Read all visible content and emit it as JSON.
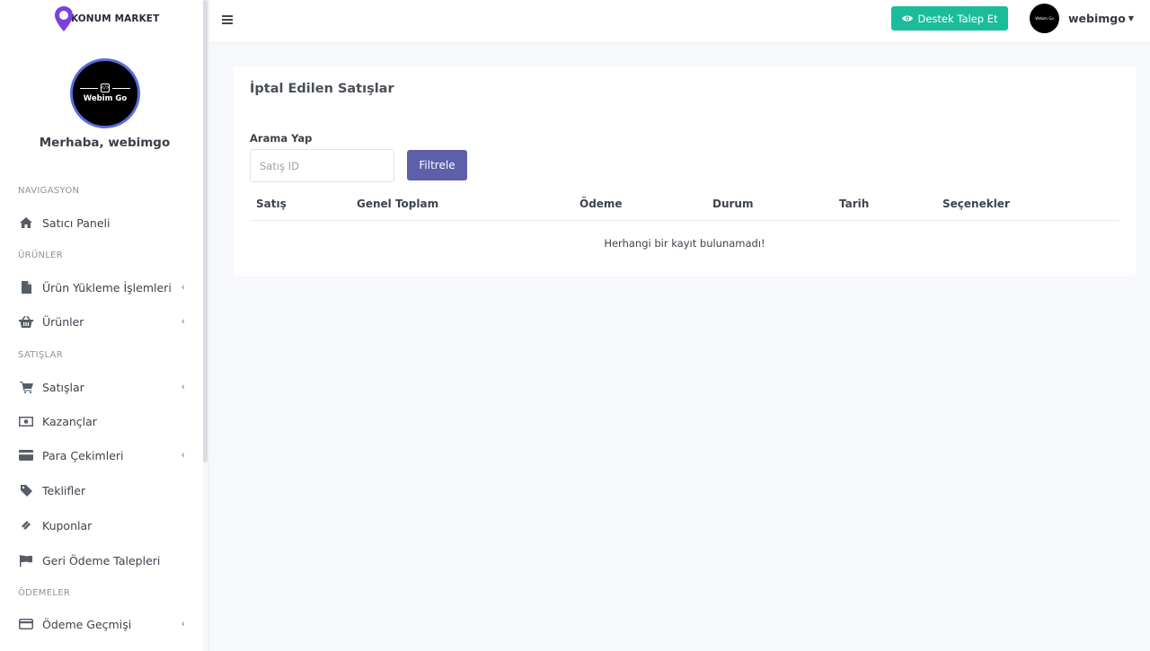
{
  "brand": {
    "name": "KONUM MARKET",
    "accent": "#7b3fe4"
  },
  "user": {
    "greeting": "Merhaba, webimgo",
    "username": "webimgo",
    "avatar_text": "Webim Go"
  },
  "topbar": {
    "support_label": "Destek Talep Et",
    "support_color": "#1abc9c"
  },
  "sidebar": {
    "sections": [
      {
        "title": "NAVIGASYON"
      },
      {
        "title": "ÜRÜNLER"
      },
      {
        "title": "SATIŞLAR"
      },
      {
        "title": "ÖDEMELER"
      }
    ],
    "items": [
      {
        "label": "Satıcı Paneli",
        "icon": "home-icon"
      },
      {
        "label": "Ürün Yükleme İşlemleri",
        "icon": "file-icon",
        "has_submenu": true
      },
      {
        "label": "Ürünler",
        "icon": "basket-icon",
        "has_submenu": true
      },
      {
        "label": "Satışlar",
        "icon": "cart-icon",
        "has_submenu": true
      },
      {
        "label": "Kazançlar",
        "icon": "money-icon"
      },
      {
        "label": "Para Çekimleri",
        "icon": "card-icon",
        "has_submenu": true
      },
      {
        "label": "Teklifler",
        "icon": "tag-icon"
      },
      {
        "label": "Kuponlar",
        "icon": "ticket-icon"
      },
      {
        "label": "Geri Ödeme Talepleri",
        "icon": "flag-icon"
      },
      {
        "label": "Ödeme Geçmişi",
        "icon": "card-icon",
        "has_submenu": true
      }
    ]
  },
  "main": {
    "title": "İptal Edilen Satışlar",
    "search": {
      "label": "Arama Yap",
      "placeholder": "Satış ID",
      "value": ""
    },
    "filter_label": "Filtrele",
    "filter_color": "#5d5fab",
    "table": {
      "columns": [
        "Satış",
        "Genel Toplam",
        "Ödeme",
        "Durum",
        "Tarih",
        "Seçenekler"
      ],
      "empty_message": "Herhangi bir kayıt bulunamadı!"
    }
  }
}
